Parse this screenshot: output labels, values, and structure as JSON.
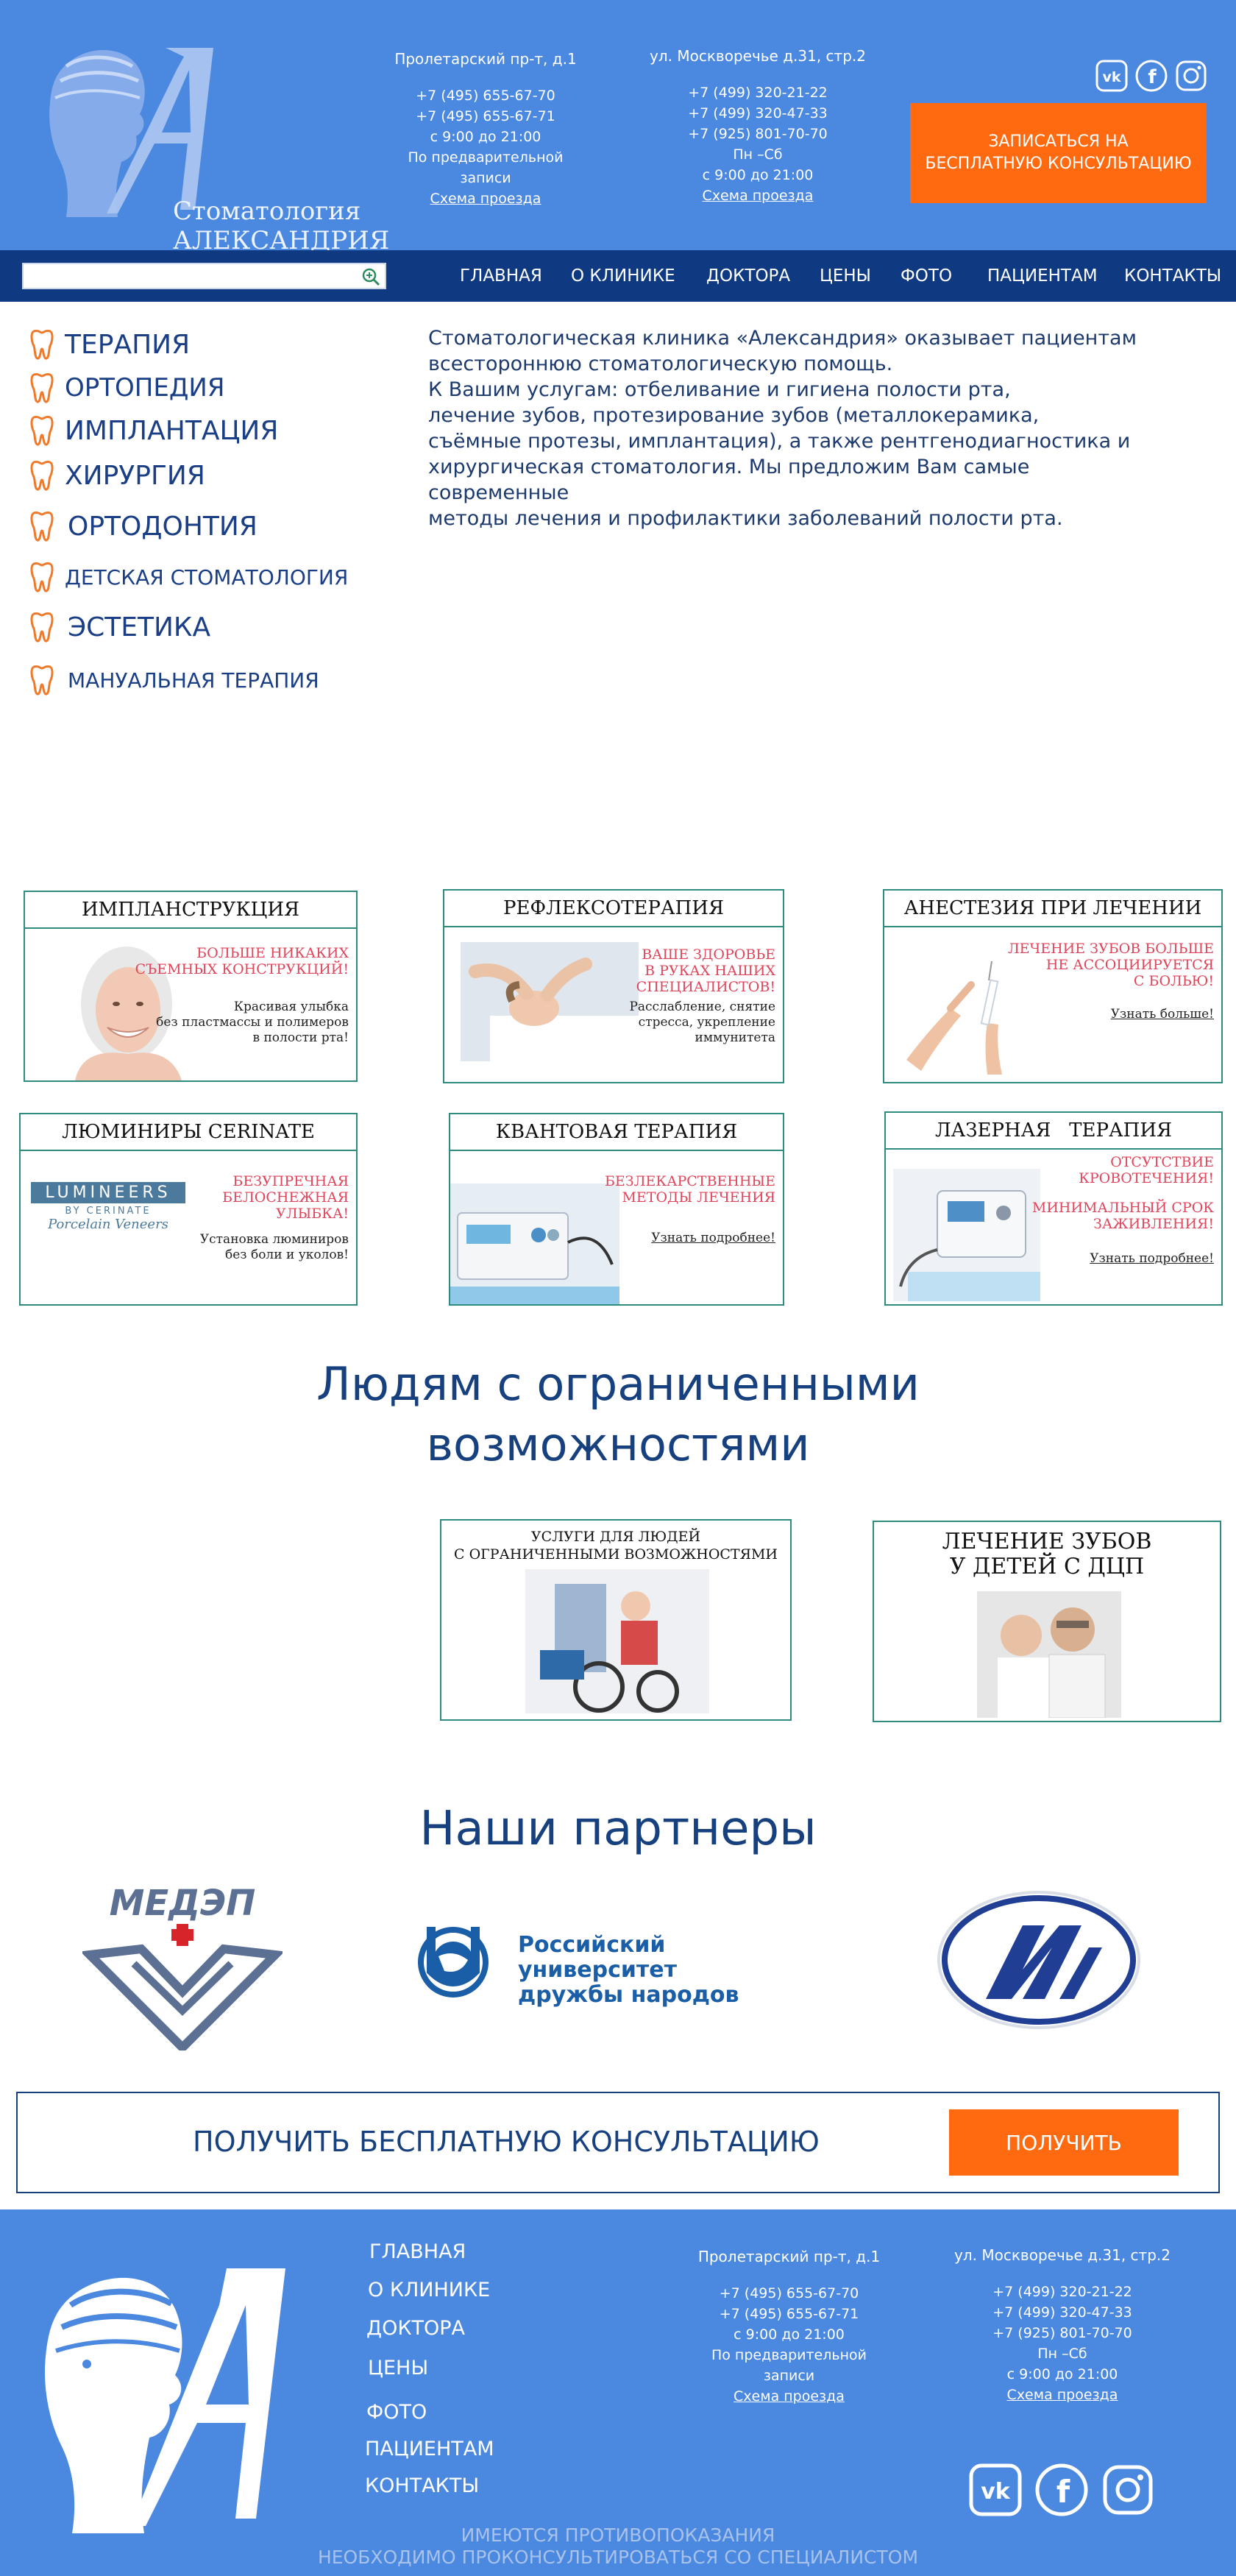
{
  "header": {
    "logo_line1": "Стоматология",
    "logo_line2": "АЛЕКСАНДРИЯ",
    "address1": {
      "title": "Пролетарский пр-т, д.1",
      "phone1": "+7 (495) 655-67-70",
      "phone2": "+7 (495) 655-67-71",
      "hours": "с 9:00 до 21:00",
      "note1": "По предварительной",
      "note2": "записи",
      "map_link": "Схема проезда"
    },
    "address2": {
      "title": "ул. Москворечье д.31, стр.2",
      "phone1": "+7 (499) 320-21-22",
      "phone2": "+7 (499) 320-47-33",
      "phone3": "+7 (925) 801-70-70",
      "days": "Пн –Сб",
      "hours": "с 9:00 до 21:00",
      "map_link": "Схема проезда"
    },
    "social_icons": [
      "vk-icon",
      "facebook-icon",
      "instagram-icon"
    ],
    "cta_line1": "ЗАПИСАТЬСЯ НА",
    "cta_line2": "БЕСПЛАТНУЮ КОНСУЛЬТАЦИЮ"
  },
  "nav": {
    "search_placeholder": "",
    "items": [
      "ГЛАВНАЯ",
      "О КЛИНИКЕ",
      "ДОКТОРА",
      "ЦЕНЫ",
      "ФОТО",
      "ПАЦИЕНТАМ",
      "КОНТАКТЫ"
    ]
  },
  "sidebar": {
    "items": [
      "ТЕРАПИЯ",
      "ОРТОПЕДИЯ",
      "ИМПЛАНТАЦИЯ",
      "ХИРУРГИЯ",
      "ОРТОДОНТИЯ",
      "ДЕТСКАЯ СТОМАТОЛОГИЯ",
      "ЭСТЕТИКА",
      "МАНУАЛЬНАЯ ТЕРАПИЯ"
    ]
  },
  "intro": {
    "line1": "Стоматологическая клиника «Александрия» оказывает пациентам",
    "line2": "всестороннюю стоматологическую помощь.",
    "line3": "К Вашим услугам: отбеливание и гигиена полости рта,",
    "line4": "лечение зубов, протезирование зубов (металлокерамика,",
    "line5": "съёмные протезы, имплантация), а также рентгенодиагностика и",
    "line6": "хирургическая стоматология. Мы предложим Вам самые современные",
    "line7": "методы лечения и профилактики заболеваний полости рта."
  },
  "cards": {
    "implant": {
      "title": "ИМПЛАНСТРУКЦИЯ",
      "red1": "БОЛЬШЕ НИКАКИХ",
      "red2": "СЪЕМНЫХ КОНСТРУКЦИЙ!",
      "dark1": "Красивая улыбка",
      "dark2": "без пластмассы и полимеров",
      "dark3": "в полости рта!"
    },
    "reflex": {
      "title": "РЕФЛЕКСОТЕРАПИЯ",
      "red1": "ВАШЕ ЗДОРОВЬЕ",
      "red2": "В РУКАХ НАШИХ",
      "red3": "СПЕЦИАЛИСТОВ!",
      "dark1": "Расслабление, снятие",
      "dark2": "стресса, укрепление",
      "dark3": "иммунитета"
    },
    "anest": {
      "title": "АНЕСТЕЗИЯ ПРИ ЛЕЧЕНИИ",
      "red1": "ЛЕЧЕНИЕ ЗУБОВ БОЛЬШЕ",
      "red2": "НЕ АССОЦИИРУЕТСЯ",
      "red3": "С БОЛЬЮ!",
      "link": "Узнать больше!"
    },
    "lumin": {
      "title": "ЛЮМИНИРЫ CERINATE",
      "brand1": "LUMINEERS",
      "brand2": "BY CERINATE",
      "brand3": "Porcelain Veneers",
      "red1": "БЕЗУПРЕЧНАЯ",
      "red2": "БЕЛОСНЕЖНАЯ",
      "red3": "УЛЫБКА!",
      "dark1": "Установка люминиров",
      "dark2": "без боли и уколов!"
    },
    "quant": {
      "title": "КВАНТОВАЯ ТЕРАПИЯ",
      "red1": "БЕЗЛЕКАРСТВЕННЫЕ",
      "red2": "МЕТОДЫ ЛЕЧЕНИЯ",
      "link": "Узнать подробнее!"
    },
    "laser": {
      "title": "ЛАЗЕРНАЯ   ТЕРАПИЯ",
      "red1": "ОТСУТСТВИЕ",
      "red2": "КРОВОТЕЧЕНИЯ!",
      "red3": "МИНИМАЛЬНЫЙ СРОК",
      "red4": "ЗАЖИВЛЕНИЯ!",
      "link": "Узнать подробнее!"
    }
  },
  "accessibility": {
    "title1": "Людям с ограниченными",
    "title2": "возможностями",
    "card1_line1": "УСЛУГИ ДЛЯ ЛЮДЕЙ",
    "card1_line2": "С ОГРАНИЧЕННЫМИ ВОЗМОЖНОСТЯМИ",
    "card2_line1": "ЛЕЧЕНИЕ ЗУБОВ",
    "card2_line2": "У ДЕТЕЙ С ДЦП"
  },
  "partners": {
    "title": "Наши партнеры",
    "medep": "МЕДЭП",
    "rudn1": "Российский университет",
    "rudn2": "дружбы народов"
  },
  "consult": {
    "text": "ПОЛУЧИТЬ БЕСПЛАТНУЮ КОНСУЛЬТАЦИЮ",
    "button": "ПОЛУЧИТЬ"
  },
  "footer": {
    "menu": [
      "ГЛАВНАЯ",
      "О КЛИНИКЕ",
      "ДОКТОРА",
      "ЦЕНЫ",
      "ФОТО",
      "ПАЦИЕНТАМ",
      "КОНТАКТЫ"
    ],
    "address1": {
      "title": "Пролетарский пр-т, д.1",
      "phone1": "+7 (495) 655-67-70",
      "phone2": "+7 (495) 655-67-71",
      "hours": "с 9:00 до 21:00",
      "note1": "По предварительной",
      "note2": "записи",
      "map_link": "Схема проезда"
    },
    "address2": {
      "title": "ул. Москворечье д.31, стр.2",
      "phone1": "+7 (499) 320-21-22",
      "phone2": "+7 (499) 320-47-33",
      "phone3": "+7 (925) 801-70-70",
      "days": "Пн –Сб",
      "hours": "с 9:00 до 21:00",
      "map_link": "Схема проезда"
    },
    "warning1": "ИМЕЮТСЯ ПРОТИВОПОКАЗАНИЯ",
    "warning2": "НЕОБХОДИМО ПРОКОНСУЛЬТИРОВАТЬСЯ СО СПЕЦИАЛИСТОМ"
  },
  "colors": {
    "header_blue": "#4b88e0",
    "nav_navy": "#0f3a82",
    "accent_orange": "#ff6a10",
    "card_border": "#2e8c7e",
    "promo_red": "#e0455b"
  }
}
